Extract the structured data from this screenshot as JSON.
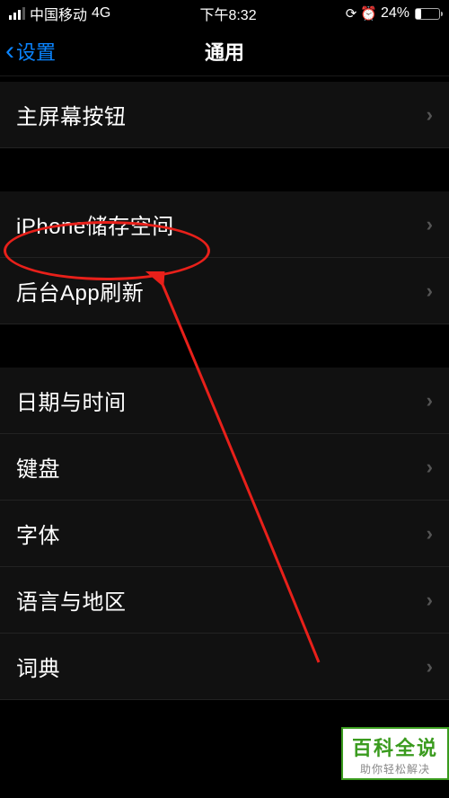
{
  "status": {
    "carrier": "中国移动",
    "network": "4G",
    "time": "下午8:32",
    "battery_pct": "24%"
  },
  "nav": {
    "back_label": "设置",
    "title": "通用"
  },
  "rows": {
    "home_button": "主屏幕按钮",
    "iphone_storage": "iPhone储存空间",
    "background_refresh": "后台App刷新",
    "date_time": "日期与时间",
    "keyboard": "键盘",
    "fonts": "字体",
    "language_region": "语言与地区",
    "dictionary": "词典"
  },
  "watermark": {
    "main": "百科全说",
    "sub": "助你轻松解决"
  }
}
